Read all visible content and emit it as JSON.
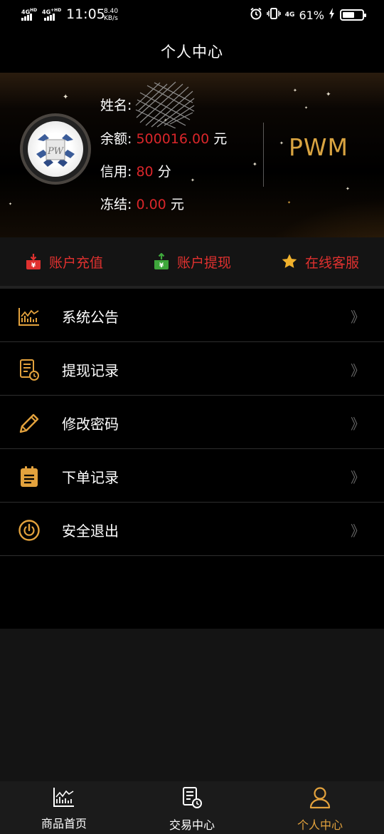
{
  "status_bar": {
    "net1": "4G HD",
    "net2": "4G⁺HD",
    "time": "11:05",
    "speed_value": "8.40",
    "speed_unit": "KB/s",
    "net3": "4G",
    "battery": "61%",
    "battery_level": 0.61
  },
  "header": {
    "title": "个人中心"
  },
  "profile": {
    "name_label": "姓名:",
    "balance_label": "余额:",
    "balance_value": "500016.00",
    "balance_unit": "元",
    "credit_label": "信用:",
    "credit_value": "80",
    "credit_unit": "分",
    "frozen_label": "冻结:",
    "frozen_value": "0.00",
    "frozen_unit": "元",
    "brand": "PWM"
  },
  "actions": [
    {
      "label": "账户充值",
      "icon": "deposit-icon",
      "color": "#e0312f"
    },
    {
      "label": "账户提现",
      "icon": "withdraw-icon",
      "color": "#3ea73b"
    },
    {
      "label": "在线客服",
      "icon": "star-icon",
      "color": "#f0b12c"
    }
  ],
  "menu": [
    {
      "label": "系统公告",
      "icon": "chart-icon",
      "arrow": "》"
    },
    {
      "label": "提现记录",
      "icon": "record-icon",
      "arrow": "》"
    },
    {
      "label": "修改密码",
      "icon": "pencil-icon",
      "arrow": "》"
    },
    {
      "label": "下单记录",
      "icon": "clipboard-icon",
      "arrow": "》"
    },
    {
      "label": "安全退出",
      "icon": "power-icon",
      "arrow": "》"
    }
  ],
  "tabs": [
    {
      "label": "商品首页",
      "icon": "chart-icon",
      "active": false
    },
    {
      "label": "交易中心",
      "icon": "record-icon",
      "active": false
    },
    {
      "label": "个人中心",
      "icon": "user-icon",
      "active": true
    }
  ],
  "colors": {
    "accent": "#e3a23d",
    "value_red": "#d9262a",
    "brand_gold": "#d9a441"
  }
}
